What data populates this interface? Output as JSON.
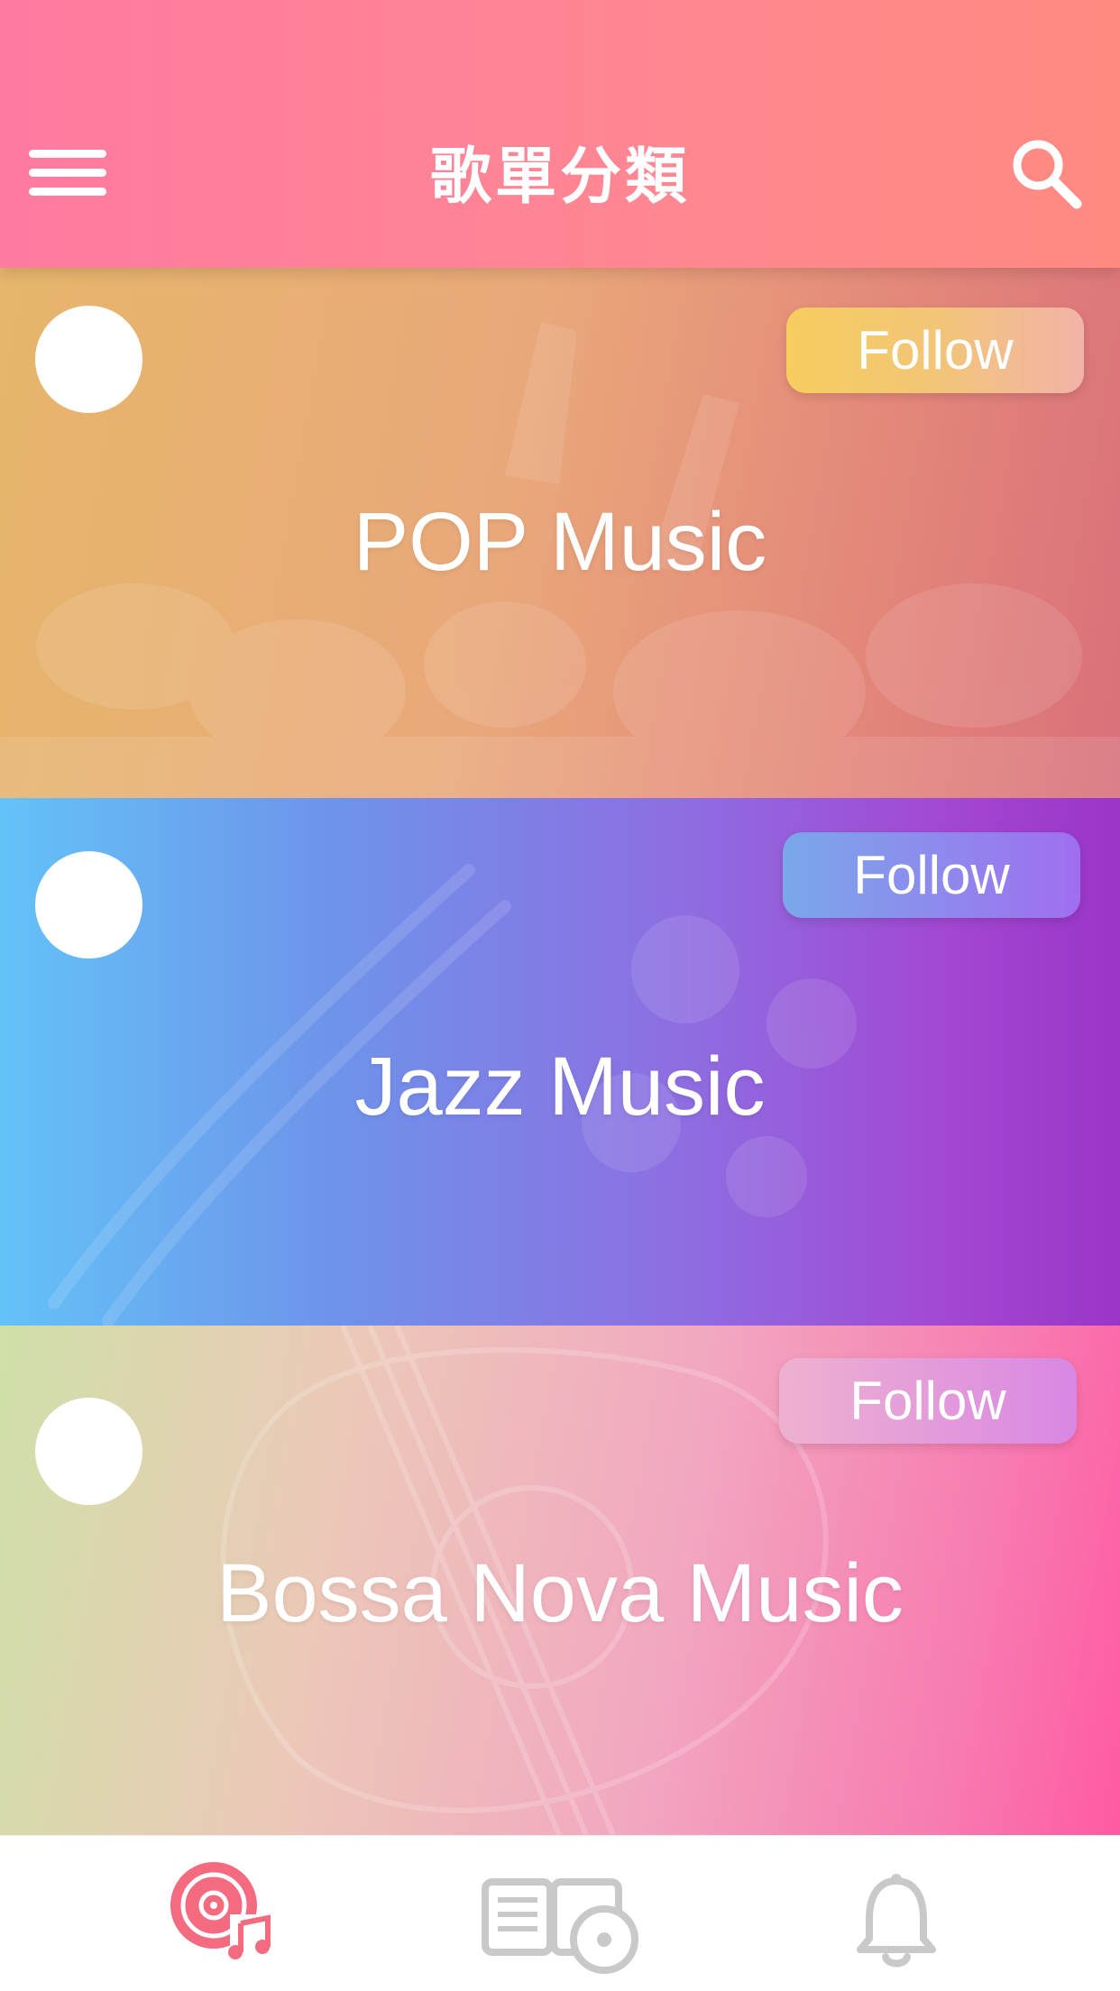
{
  "header": {
    "title": "歌單分類",
    "menu_icon": "menu-icon",
    "search_icon": "search-icon",
    "background_colors": [
      "#ff7aa0",
      "#ff8a80"
    ]
  },
  "categories": [
    {
      "title": "POP Music",
      "follow_label": "Follow",
      "gradient": [
        "#e6b66b",
        "#d9707a"
      ],
      "follow_gradient": [
        "#f7cd5e",
        "#f2b3a8"
      ]
    },
    {
      "title": "Jazz Music",
      "follow_label": "Follow",
      "gradient": [
        "#63c2f8",
        "#9a35c8"
      ],
      "follow_gradient": [
        "#7aa8ea",
        "#a06ef0"
      ]
    },
    {
      "title": "Bossa Nova Music",
      "follow_label": "Follow",
      "gradient": [
        "#cfe0a8",
        "#ff5aa3"
      ],
      "follow_gradient": [
        "#eeb1cf",
        "#d987e4"
      ]
    }
  ],
  "tabbar": {
    "tabs": [
      {
        "icon": "music-disc-icon",
        "active": true,
        "color": "#f46a7f"
      },
      {
        "icon": "book-disc-icon",
        "active": false,
        "color": "#c9c9c9"
      },
      {
        "icon": "bell-icon",
        "active": false,
        "color": "#c9c9c9"
      }
    ]
  }
}
